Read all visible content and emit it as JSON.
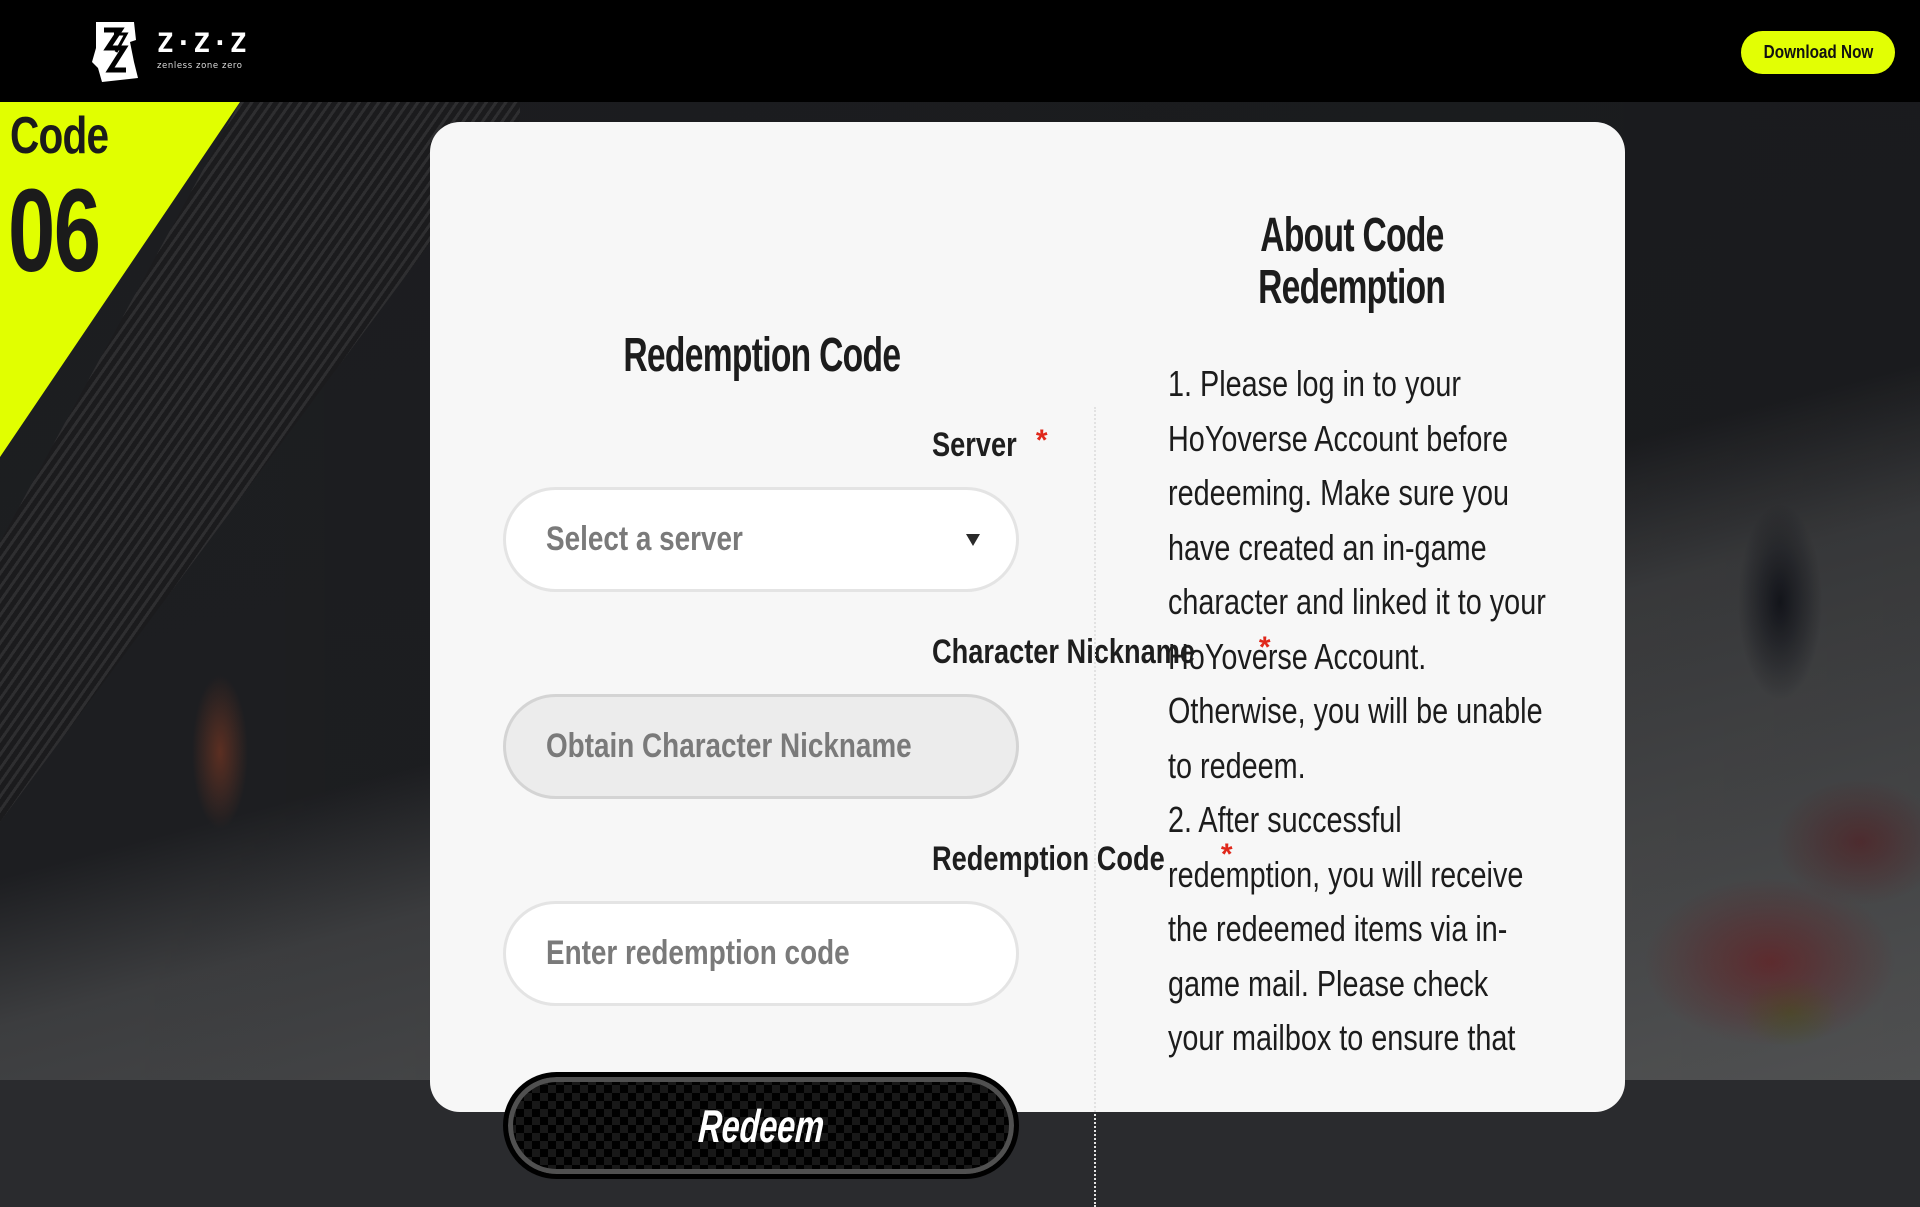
{
  "header": {
    "logo_title": "Z·Z·Z",
    "logo_subtitle": "zenless zone zero",
    "download_label": "Download Now",
    "accent_color": "#e2ff04"
  },
  "badge": {
    "label": "Code",
    "number": "06"
  },
  "form": {
    "title": "Redemption Code",
    "required_mark": "*",
    "server": {
      "label": "Server",
      "placeholder": "Select a server",
      "icon": "caret-down-icon"
    },
    "nickname": {
      "label": "Character Nickname",
      "placeholder": "Obtain Character Nickname"
    },
    "code": {
      "label": "Redemption Code",
      "placeholder": "Enter redemption code"
    },
    "submit_label": "Redeem"
  },
  "about": {
    "title_line1": "About Code",
    "title_line2": "Redemption",
    "paragraphs": [
      "1. Please log in to your HoYoverse Account before redeeming. Make sure you have created an in-game character and linked it to your HoYoverse Account. Otherwise, you will be unable to redeem.",
      "2. After successful redemption, you will receive the redeemed items via in-game mail. Please check your mailbox to ensure that"
    ]
  }
}
